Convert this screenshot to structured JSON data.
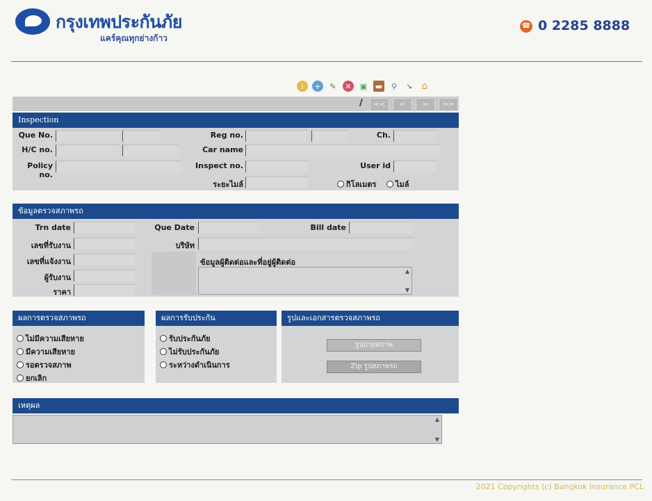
{
  "header": {
    "brand": "กรุงเทพประกันภัย",
    "slogan": "แคร์คุณทุกย่างก้าว",
    "phone": "0 2285 8888"
  },
  "toolbar": {
    "icons": [
      "info-icon",
      "add-icon",
      "edit-icon",
      "delete-icon",
      "save-icon",
      "card-icon",
      "search-icon",
      "arrow-icon",
      "home-icon"
    ]
  },
  "pager": {
    "slash": "/",
    "first": "<<",
    "prev": "<",
    "next": ">",
    "last": ">>"
  },
  "inspection": {
    "title": "Inspection",
    "que_no": "Que No.",
    "hc_no": "H/C no.",
    "policy_no": "Policy no.",
    "reg_no": "Reg no.",
    "car_name": "Car name",
    "inspect_no": "Inspect no.",
    "distance": "ระยะไมล์",
    "ch": "Ch.",
    "user_id": "User id",
    "unit_km": "กิโลเมตร",
    "unit_mile": "ไมล์"
  },
  "vehicle_info": {
    "title": "ข้อมูลตรวจสภาพรถ",
    "trn_date": "Trn date",
    "receive_no": "เลขที่รับงาน",
    "notify_no": "เลขที่แจ้งงาน",
    "receiver": "ผู้รับงาน",
    "price": "ราคา",
    "que_date": "Que Date",
    "company": "บริษัท",
    "bill_date": "Bill date",
    "contact_info": "ข้อมูลผู้ติดต่อและที่อยู่ผู้ติดต่อ"
  },
  "inspect_result": {
    "title": "ผลการตรวจสภาพรถ",
    "options": [
      "ไม่มีความเสียหาย",
      "มีความเสียหาย",
      "รอตรวจสภาพ",
      "ยกเลิก"
    ]
  },
  "insure_result": {
    "title": "ผลการรับประกัน",
    "options": [
      "รับประกันภัย",
      "ไม่รับประกันภัย",
      "ระหว่างดำเนินการ"
    ]
  },
  "docs": {
    "title": "รูปและเอกสารตรวจสภาพรถ",
    "btn_view": "รูปถ่ายสภาพ",
    "btn_zip": "Zip รูปสภาพรถ"
  },
  "reason": {
    "title": "เหตุผล"
  },
  "footer": {
    "copyright": "2021 Copyrights (c) Bangkok Insurance PCL"
  }
}
